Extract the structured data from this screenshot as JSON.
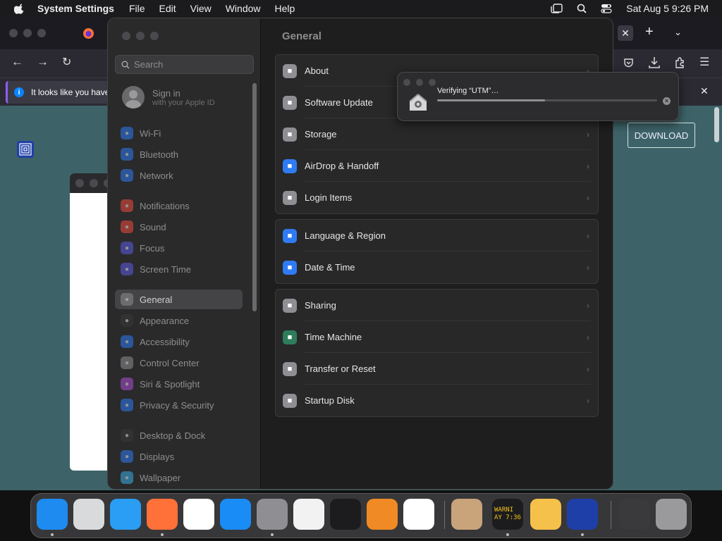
{
  "menubar": {
    "app_name": "System Settings",
    "menus": [
      "File",
      "Edit",
      "View",
      "Window",
      "Help"
    ],
    "clock": "Sat Aug 5  9:26 PM"
  },
  "browser": {
    "notice_text": "It looks like you have",
    "download_button": "DOWNLOAD"
  },
  "settings": {
    "search_placeholder": "Search",
    "signin": {
      "title": "Sign in",
      "subtitle": "with your Apple ID"
    },
    "sidebar": [
      {
        "label": "Wi-Fi",
        "icon": "wifi-icon",
        "color": "#2f7bf5"
      },
      {
        "label": "Bluetooth",
        "icon": "bluetooth-icon",
        "color": "#2f7bf5"
      },
      {
        "label": "Network",
        "icon": "globe-icon",
        "color": "#2f7bf5"
      },
      {
        "label": "Notifications",
        "icon": "bell-icon",
        "color": "#f04b3e"
      },
      {
        "label": "Sound",
        "icon": "speaker-icon",
        "color": "#f04b3e"
      },
      {
        "label": "Focus",
        "icon": "moon-icon",
        "color": "#5e5ce6"
      },
      {
        "label": "Screen Time",
        "icon": "hourglass-icon",
        "color": "#5e5ce6"
      },
      {
        "label": "General",
        "icon": "gear-icon",
        "color": "#8e8e93"
      },
      {
        "label": "Appearance",
        "icon": "appearance-icon",
        "color": "#3a3a3c"
      },
      {
        "label": "Accessibility",
        "icon": "accessibility-icon",
        "color": "#2f7bf5"
      },
      {
        "label": "Control Center",
        "icon": "control-center-icon",
        "color": "#8e8e93"
      },
      {
        "label": "Siri & Spotlight",
        "icon": "siri-icon",
        "color": "#b04fd6"
      },
      {
        "label": "Privacy & Security",
        "icon": "hand-icon",
        "color": "#2f7bf5"
      },
      {
        "label": "Desktop & Dock",
        "icon": "desktop-icon",
        "color": "#3a3a3c"
      },
      {
        "label": "Displays",
        "icon": "display-icon",
        "color": "#2f7bf5"
      },
      {
        "label": "Wallpaper",
        "icon": "wallpaper-icon",
        "color": "#3ab0e8"
      }
    ],
    "active_item": "General",
    "title": "General",
    "groups": [
      [
        {
          "label": "About",
          "icon": "about-icon",
          "color": "#8e8e93"
        },
        {
          "label": "Software Update",
          "icon": "software-update-icon",
          "color": "#8e8e93"
        },
        {
          "label": "Storage",
          "icon": "storage-icon",
          "color": "#8e8e93"
        },
        {
          "label": "AirDrop & Handoff",
          "icon": "airdrop-icon",
          "color": "#2f7bf5"
        },
        {
          "label": "Login Items",
          "icon": "list-icon",
          "color": "#8e8e93"
        }
      ],
      [
        {
          "label": "Language & Region",
          "icon": "globe-icon",
          "color": "#2f7bf5"
        },
        {
          "label": "Date & Time",
          "icon": "calendar-icon",
          "color": "#2f7bf5"
        }
      ],
      [
        {
          "label": "Sharing",
          "icon": "sharing-icon",
          "color": "#8e8e93"
        },
        {
          "label": "Time Machine",
          "icon": "time-machine-icon",
          "color": "#2e7d5b"
        },
        {
          "label": "Transfer or Reset",
          "icon": "reset-icon",
          "color": "#8e8e93"
        },
        {
          "label": "Startup Disk",
          "icon": "disk-icon",
          "color": "#8e8e93"
        }
      ]
    ]
  },
  "verify_popup": {
    "message": "Verifying “UTM”…",
    "progress": 0.49
  },
  "dock": [
    {
      "name": "finder-icon",
      "color": "#1e8bf0",
      "running": true
    },
    {
      "name": "launchpad-icon",
      "color": "#d9dadb",
      "running": false
    },
    {
      "name": "safari-icon",
      "color": "#2a9df4",
      "running": false
    },
    {
      "name": "firefox-icon",
      "color": "#ff7139",
      "running": true
    },
    {
      "name": "chrome-icon",
      "color": "#ffffff",
      "running": false
    },
    {
      "name": "app-store-icon",
      "color": "#1a8cf5",
      "running": false
    },
    {
      "name": "system-settings-icon",
      "color": "#8e8e93",
      "running": true
    },
    {
      "name": "textedit-icon",
      "color": "#f2f2f2",
      "running": false
    },
    {
      "name": "terminal-icon",
      "color": "#1c1c1e",
      "running": false
    },
    {
      "name": "garageband-icon",
      "color": "#f08a24",
      "running": false
    },
    {
      "name": "vscode-icon",
      "color": "#ffffff",
      "running": false
    },
    {
      "name": "installer-icon",
      "color": "#c9a37a",
      "running": false
    },
    {
      "name": "console-icon",
      "color": "#1c1c1e",
      "running": true
    },
    {
      "name": "home-icon",
      "color": "#f6c14a",
      "running": false
    },
    {
      "name": "utm-icon",
      "color": "#1f3fa8",
      "running": true
    },
    {
      "name": "downloads-stack-icon",
      "color": "#3a3a3c",
      "running": false
    },
    {
      "name": "trash-icon",
      "color": "#9a9a9c",
      "running": false
    }
  ],
  "dock_console_text": "WARNI\nAY 7:36"
}
